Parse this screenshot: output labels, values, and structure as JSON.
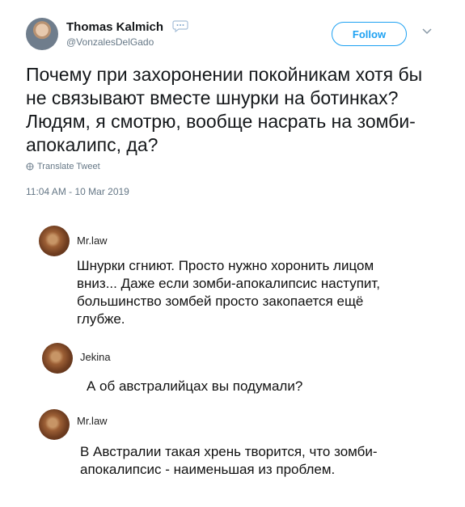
{
  "tweet": {
    "author_name": "Thomas Kalmich",
    "handle": "@VonzalesDelGado",
    "follow_label": "Follow",
    "text": "Почему при захоронении покойникам хотя бы не связывают вместе шнурки на ботинках? Людям, я смотрю, вообще насрать на зомби-апокалипс, да?",
    "translate_label": "Translate Tweet",
    "timestamp": "11:04 AM - 10 Mar 2019"
  },
  "comments": [
    {
      "name": "Mr.law",
      "text": "Шнурки сгниют. Просто нужно хоронить лицом вниз... Даже если зомби-апокалипсис наступит, большинство зомбей просто закопается ещё глубже."
    },
    {
      "name": "Jekina",
      "text": "А об австралийцах вы подумали?"
    },
    {
      "name": "Mr.law",
      "text": "В Австралии такая хрень творится, что зомби-апокалипсис - наименьшая из проблем."
    }
  ],
  "colors": {
    "link_blue": "#1da1f2",
    "secondary_text": "#657786"
  }
}
